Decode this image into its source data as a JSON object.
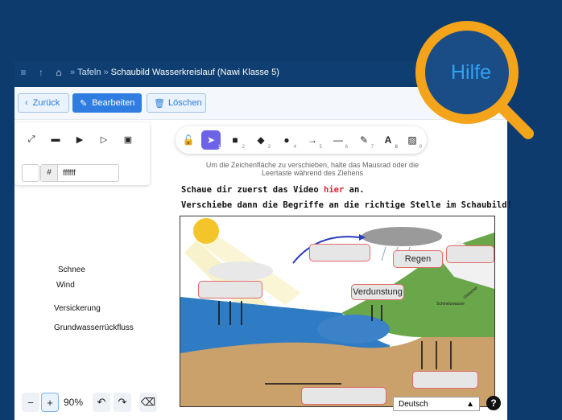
{
  "nav": {
    "menu_icon": "menu-icon",
    "up_icon": "arrow-up-icon",
    "home_icon": "home-icon",
    "crumb1": "Tafeln",
    "separator": "»",
    "crumb2": "Schaubild Wasserkreislauf (Nawi Klasse 5)"
  },
  "actions": {
    "back": "Zurück",
    "back_icon": "chevron-left-icon",
    "edit": "Bearbeiten",
    "edit_icon": "edit-icon",
    "delete": "Löschen",
    "delete_icon": "trash-icon"
  },
  "color": {
    "hash": "#",
    "value": "ffffff"
  },
  "hint": "Um die Zeichenfläche zu verschieben, halte das Mausrad oder die Leertaste während des Ziehens",
  "line1": {
    "before": "Schaue dir zuerst das Video ",
    "link": "hier",
    "after": " an."
  },
  "line2": "Verschiebe dann die Begriffe an die richtige Stelle im Schaubild!",
  "terms": [
    "Schnee",
    "Wind",
    "Versickerung",
    "Grundwasserrückfluss"
  ],
  "diagram": {
    "regen": "Regen",
    "verdunstung": "Verdunstung",
    "schmelzwasser": "Schmelzwasser",
    "gletscher": "Gletscher"
  },
  "tool_numbers": [
    "1",
    "2",
    "3",
    "4",
    "5",
    "6",
    "7",
    "8",
    "9"
  ],
  "zoom": {
    "minus": "−",
    "plus": "+",
    "value": "90%"
  },
  "language": "Deutsch",
  "help_q": "?",
  "hilfe": "Hilfe",
  "colors": {
    "background": "#0d3b6e",
    "accent": "#2f7de1",
    "magnifier": "#f4a41a",
    "tool_selected": "#6c63e8"
  }
}
